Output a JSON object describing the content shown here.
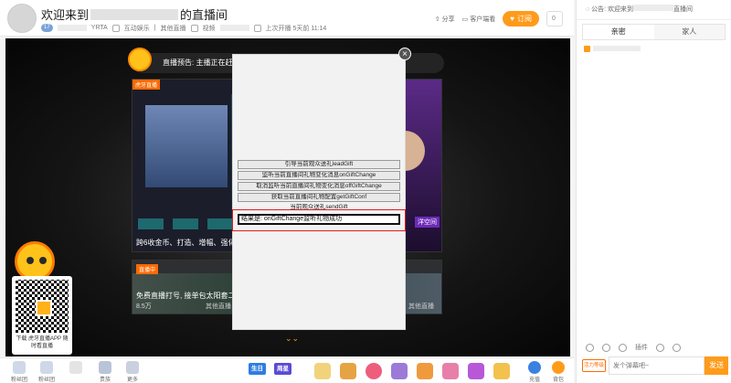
{
  "header": {
    "title_prefix": "欢迎来到",
    "title_suffix": "的直播间",
    "level": "17",
    "room_id": "YRTA",
    "category_1": "互动娱乐",
    "category_2": "其他直播",
    "video_label": "视频",
    "last_live": "上次开播 5天前 11:14",
    "share": "分享",
    "client": "客户端看",
    "subscribe": "订阅",
    "subscribe_count": "0"
  },
  "video": {
    "announce": "直播预告: 主播正在赶来",
    "card1_tag": "虎牙直播",
    "card1_caption": "跨6收金币、打造、增幅、强化",
    "card1_strip": "洋空间",
    "card2_tag": "直播中",
    "card2_caption": "免费直播打号, 接单包太阳套二",
    "card2_viewers": "8.5万",
    "card2_category": "其他直播",
    "card2_category_right": "其他直播",
    "scroll_hint": "⌄⌄",
    "qr_text": "下载 虎牙直播APP 随时看直播"
  },
  "modal": {
    "close": "×",
    "buttons": [
      "引导当前观众送礼leadGift",
      "监听当前直播间礼物变化消息onGiftChange",
      "取消监听当前直播间礼物变化消息offGiftChange",
      "获取当前直播间礼物配置getGiftConf",
      "当前观众送礼sendGift"
    ],
    "result": "结果是: onGiftChange监听礼物成功"
  },
  "giftbar": {
    "left_items": [
      "粉丝团",
      "粉丝团",
      "",
      "贵族",
      "更多"
    ],
    "badge_1": "生日",
    "badge_2": "周星",
    "recharge": "充值",
    "backpack": "背包"
  },
  "sidebar": {
    "notice": "公告: 欢迎来到",
    "notice_suffix": "直播间",
    "tabs": [
      "亲密",
      "家人"
    ],
    "tools_label": "插件",
    "level_tag": "活力等级",
    "chat_placeholder": "发个弹幕吧~",
    "send": "发送"
  },
  "colors": {
    "accent": "#ff9b1a",
    "highlight_frame": "#e01b1b"
  }
}
